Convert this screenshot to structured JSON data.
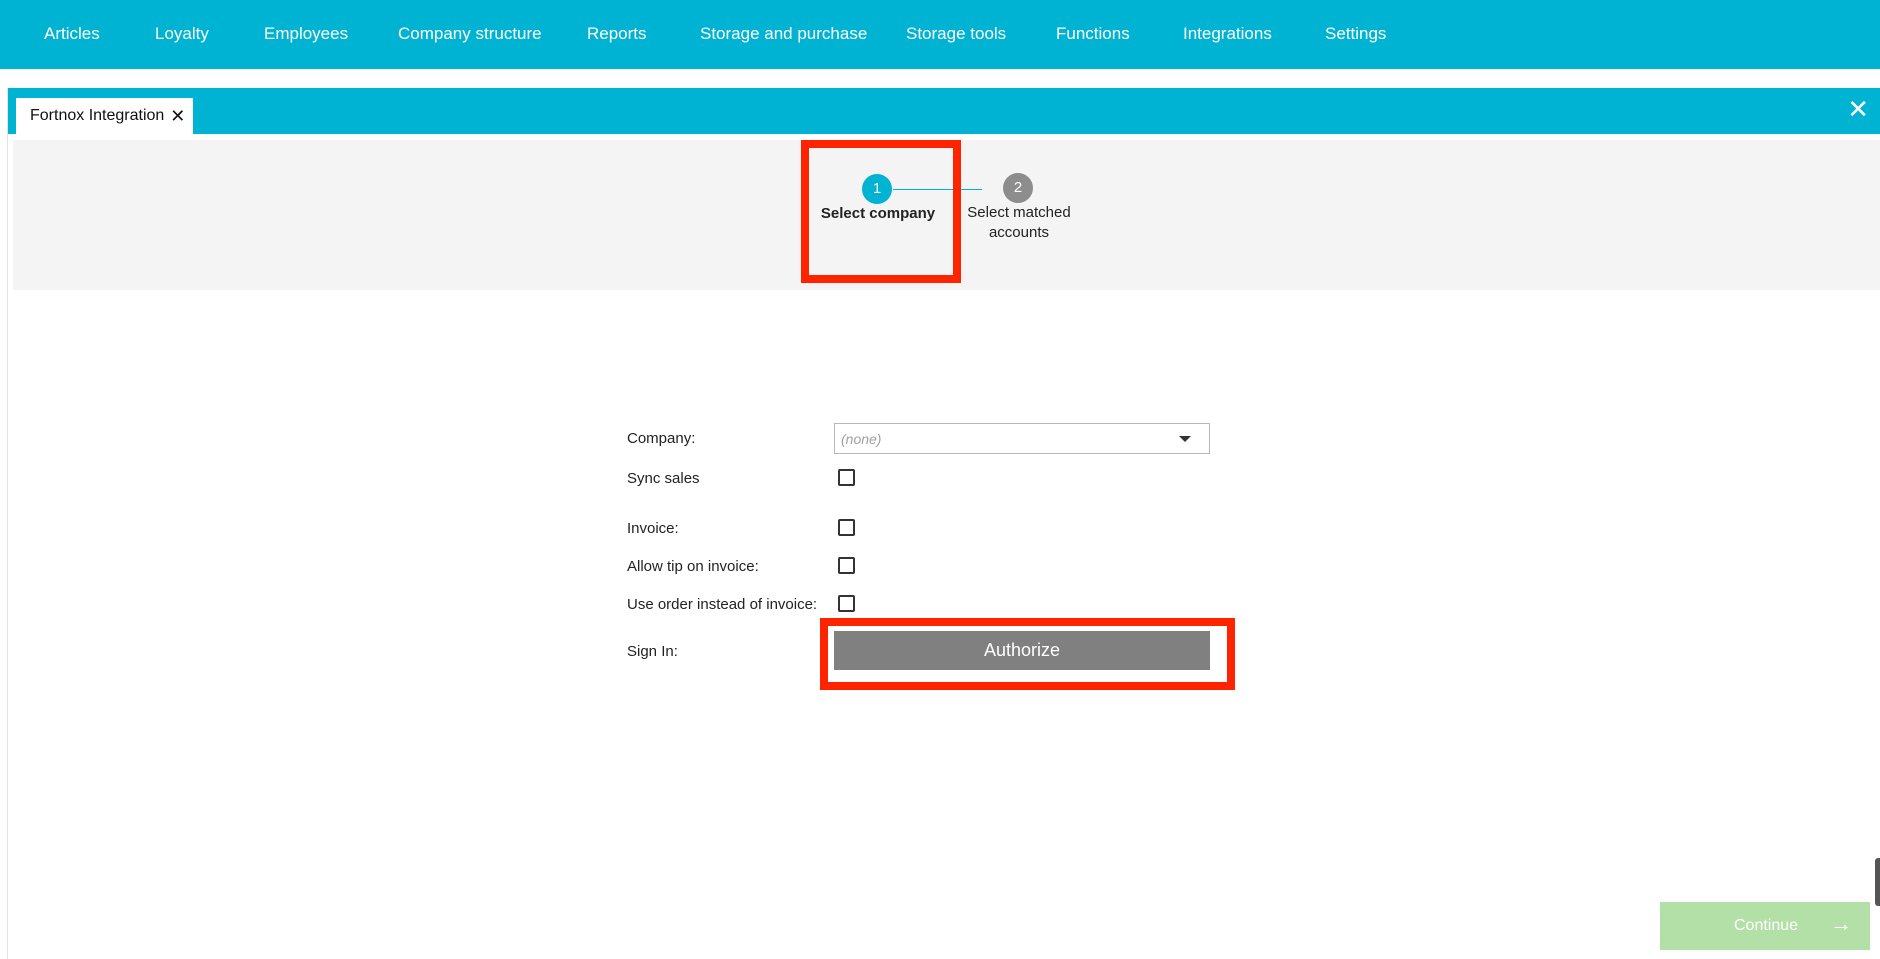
{
  "nav": {
    "items": [
      "Articles",
      "Loyalty",
      "Employees",
      "Company structure",
      "Reports",
      "Storage and purchase",
      "Storage tools",
      "Functions",
      "Integrations",
      "Settings"
    ]
  },
  "window": {
    "tab_label": "Fortnox Integration"
  },
  "stepper": {
    "steps": [
      {
        "number": "1",
        "label": "Select company"
      },
      {
        "number": "2",
        "label_line1": "Select matched",
        "label_line2": "accounts"
      }
    ]
  },
  "form": {
    "company_label": "Company:",
    "company_value": "(none)",
    "sync_sales_label": "Sync sales",
    "invoice_label": "Invoice:",
    "allow_tip_label": "Allow tip on invoice:",
    "use_order_label": "Use order instead of invoice:",
    "sign_in_label": "Sign In:",
    "authorize_label": "Authorize"
  },
  "footer": {
    "continue_label": "Continue"
  },
  "colors": {
    "accent": "#00b3d2",
    "highlight": "#ff2400",
    "button_gray": "#808080",
    "continue_disabled": "#b3e0a6"
  },
  "icons": {
    "tab_close": "close-icon",
    "window_close": "close-icon",
    "dropdown": "chevron-down-icon",
    "continue": "arrow-right-icon"
  }
}
